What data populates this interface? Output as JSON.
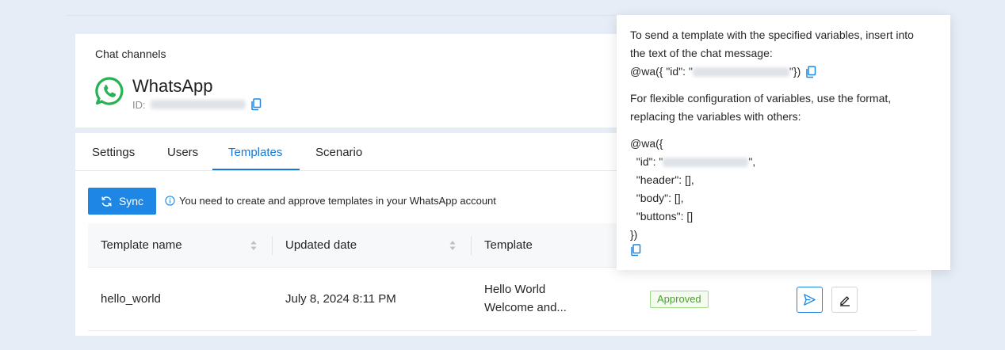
{
  "card": {
    "label": "Chat channels",
    "title": "WhatsApp",
    "id_label": "ID:"
  },
  "tabs": [
    "Settings",
    "Users",
    "Templates",
    "Scenario"
  ],
  "active_tab": "Templates",
  "toolbar": {
    "sync_label": "Sync",
    "notice": "You need to create and approve templates in your WhatsApp account"
  },
  "table": {
    "columns": [
      "Template name",
      "Updated date",
      "Template"
    ],
    "rows": [
      {
        "name": "hello_world",
        "updated": "July 8, 2024 8:11 PM",
        "template_line1": "Hello World",
        "template_line2": "Welcome and...",
        "status": "Approved"
      }
    ]
  },
  "popover": {
    "intro_line1": "To send a template with the specified variables, insert into",
    "intro_line2": "the text of the chat message:",
    "code_prefix": "@wa({ \"id\": \"",
    "code_suffix": "\"})",
    "flex_line1": "For flexible configuration of variables, use the format,",
    "flex_line2": "replacing the variables with others:",
    "block_open": "@wa({",
    "id_key": "  \"id\": \"",
    "id_end": "\",",
    "header_line": "  \"header\": [],",
    "body_line": "  \"body\": [],",
    "buttons_line": "  \"buttons\": []",
    "block_close": "})"
  },
  "colors": {
    "accent": "#1677d4",
    "whatsapp": "#25b353",
    "approved": "#4aa22c"
  }
}
